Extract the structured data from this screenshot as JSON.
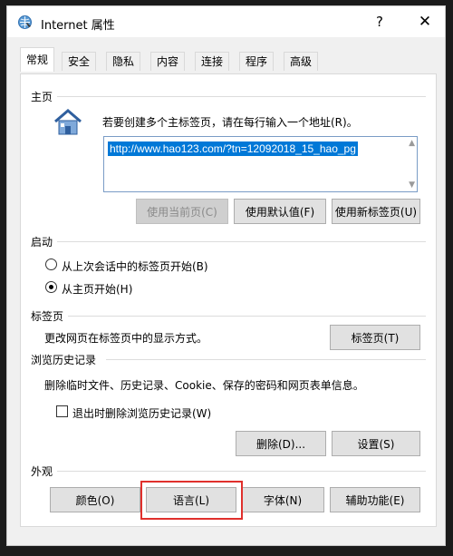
{
  "window": {
    "title": "Internet 属性",
    "help_glyph": "?",
    "close_glyph": "✕"
  },
  "tabs": [
    {
      "label": "常规",
      "active": true
    },
    {
      "label": "安全"
    },
    {
      "label": "隐私"
    },
    {
      "label": "内容"
    },
    {
      "label": "连接"
    },
    {
      "label": "程序"
    },
    {
      "label": "高级"
    }
  ],
  "home": {
    "title": "主页",
    "description": "若要创建多个主标签页，请在每行输入一个地址(R)。",
    "url": "http://www.hao123.com/?tn=12092018_15_hao_pg",
    "buttons": {
      "use_current": "使用当前页(C)",
      "use_default": "使用默认值(F)",
      "use_new_tab": "使用新标签页(U)"
    }
  },
  "startup": {
    "title": "启动",
    "option_last_session": "从上次会话中的标签页开始(B)",
    "option_home": "从主页开始(H)",
    "selected": "home"
  },
  "tabs_section": {
    "title": "标签页",
    "description": "更改网页在标签页中的显示方式。",
    "button": "标签页(T)"
  },
  "history": {
    "title": "浏览历史记录",
    "description": "删除临时文件、历史记录、Cookie、保存的密码和网页表单信息。",
    "checkbox_label": "退出时删除浏览历史记录(W)",
    "checkbox_checked": false,
    "delete_button": "删除(D)...",
    "settings_button": "设置(S)"
  },
  "appearance": {
    "title": "外观",
    "colors_button": "颜色(O)",
    "languages_button": "语言(L)",
    "fonts_button": "字体(N)",
    "accessibility_button": "辅助功能(E)"
  },
  "colors": {
    "selection": "#0078d7",
    "highlight_box": "#e0302c"
  }
}
